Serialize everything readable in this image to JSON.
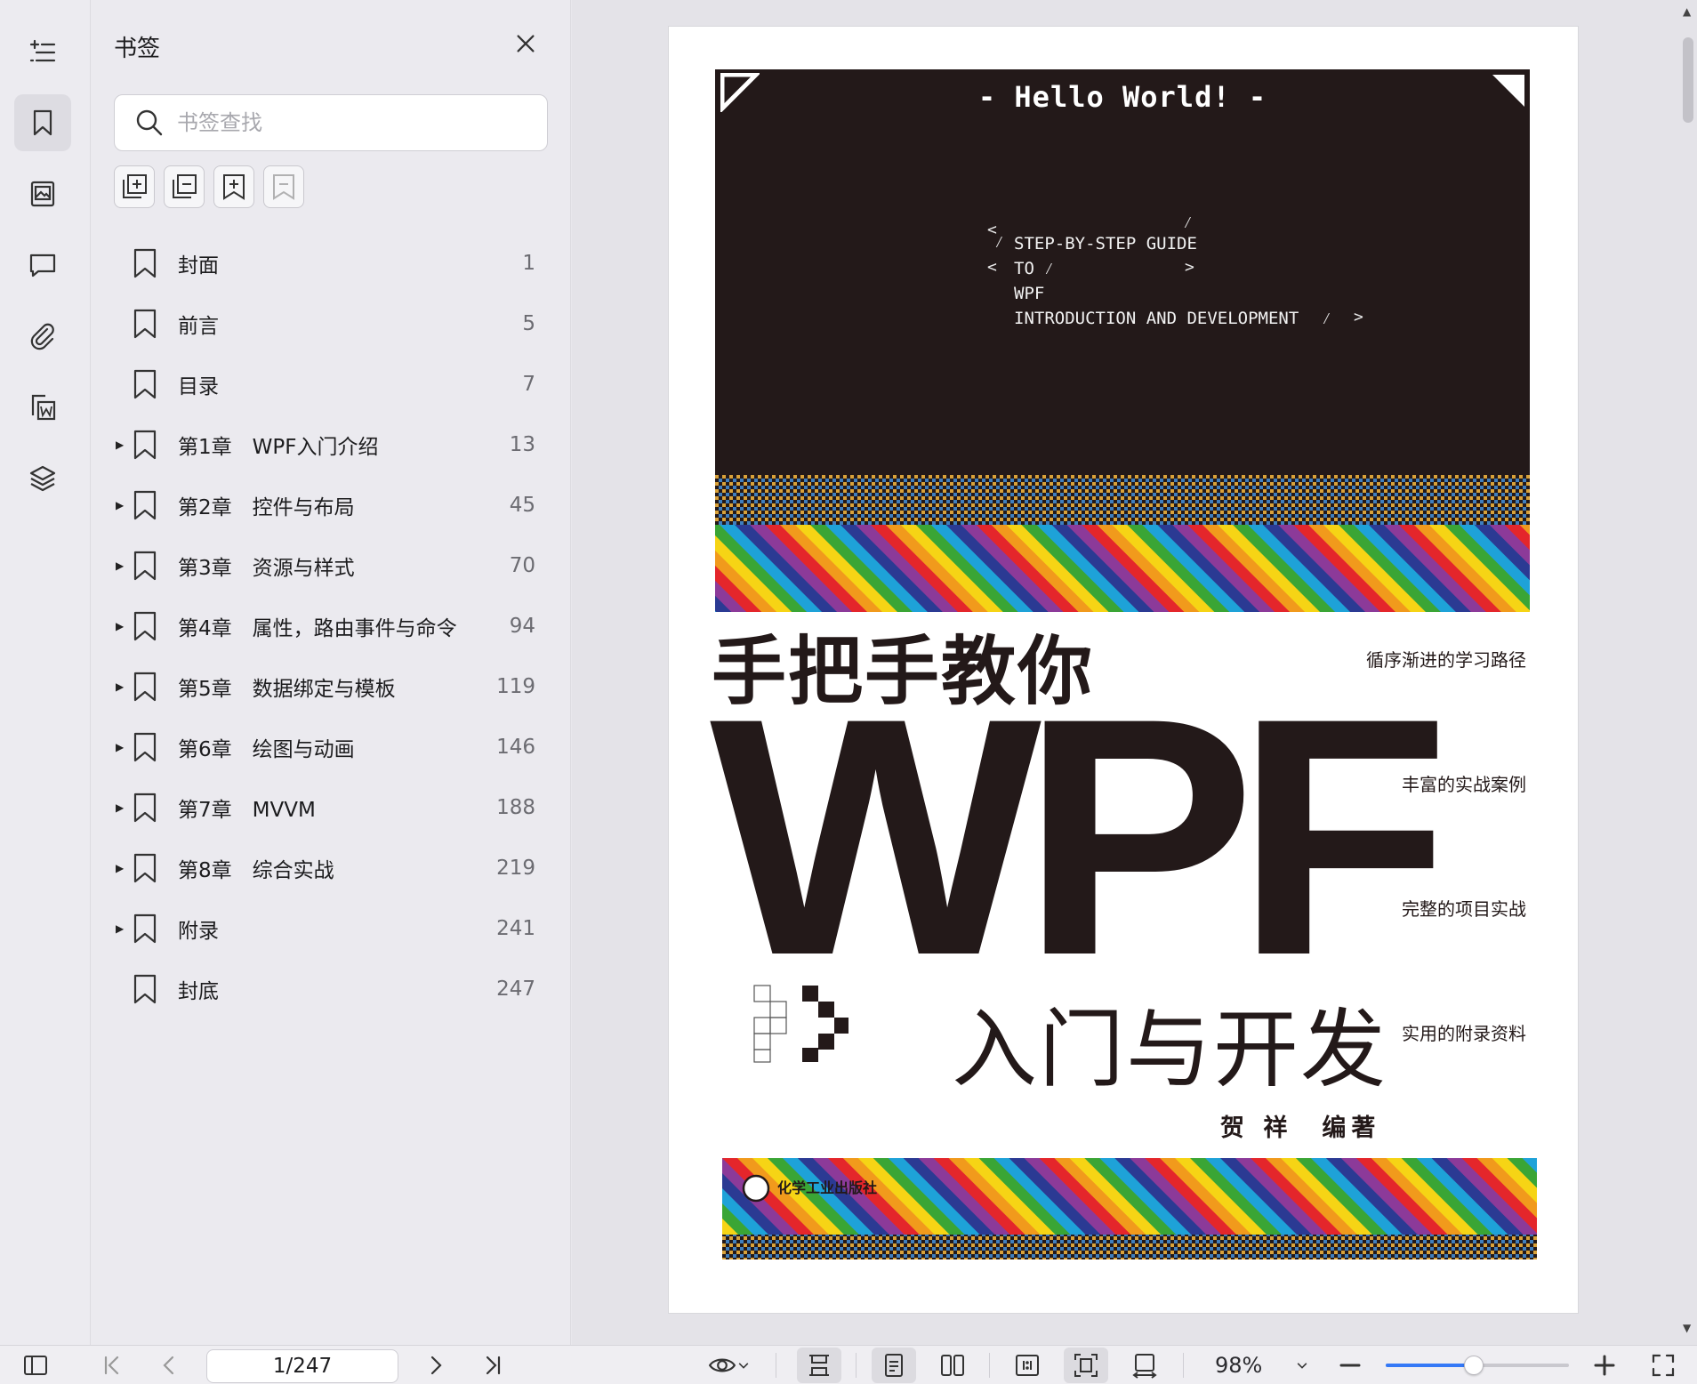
{
  "sidebar_rail": {
    "items": [
      {
        "name": "outline-icon"
      },
      {
        "name": "bookmark-icon",
        "active": true
      },
      {
        "name": "thumbnail-icon"
      },
      {
        "name": "comment-icon"
      },
      {
        "name": "attachment-icon"
      },
      {
        "name": "convert-word-icon"
      },
      {
        "name": "layers-icon"
      }
    ]
  },
  "bookmark_panel": {
    "title": "书签",
    "search_placeholder": "书签查找",
    "tools": [
      "add-sub-bookmark-icon",
      "add-sibling-bookmark-icon",
      "add-bookmark-icon",
      "remove-bookmark-icon"
    ],
    "items": [
      {
        "label": "封面",
        "page": "1",
        "expandable": false
      },
      {
        "label": "前言",
        "page": "5",
        "expandable": false
      },
      {
        "label": "目录",
        "page": "7",
        "expandable": false
      },
      {
        "label": "第1章　WPF入门介绍",
        "page": "13",
        "expandable": true
      },
      {
        "label": "第2章　控件与布局",
        "page": "45",
        "expandable": true
      },
      {
        "label": "第3章　资源与样式",
        "page": "70",
        "expandable": true
      },
      {
        "label": "第4章　属性，路由事件与命令",
        "page": "94",
        "expandable": true
      },
      {
        "label": "第5章　数据绑定与模板",
        "page": "119",
        "expandable": true
      },
      {
        "label": "第6章　绘图与动画",
        "page": "146",
        "expandable": true
      },
      {
        "label": "第7章　MVVM",
        "page": "188",
        "expandable": true
      },
      {
        "label": "第8章　综合实战",
        "page": "219",
        "expandable": true
      },
      {
        "label": "附录",
        "page": "241",
        "expandable": true
      },
      {
        "label": "封底",
        "page": "247",
        "expandable": false
      }
    ]
  },
  "cover": {
    "hello": "- Hello World! -",
    "guide_lines": [
      "STEP-BY-STEP GUIDE",
      "TO",
      "WPF",
      "INTRODUCTION AND DEVELOPMENT"
    ],
    "title_cn": "手把手教你",
    "title_main": "WPF",
    "title_sub": "入门与开发",
    "features": [
      "循序渐进的学习路径",
      "丰富的实战案例",
      "完整的项目实战",
      "实用的附录资料"
    ],
    "author": "贺 祥　编著",
    "publisher": "化学工业出版社"
  },
  "bottom_bar": {
    "page_value": "1/247",
    "zoom": "98%",
    "zoom_level": 0.48
  }
}
